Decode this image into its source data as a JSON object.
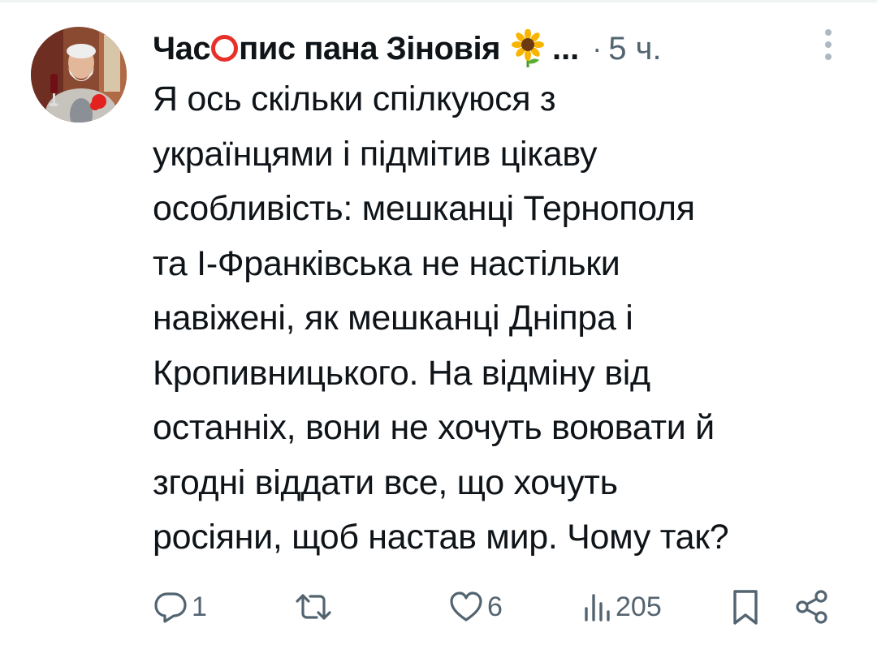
{
  "post": {
    "author": {
      "name_part1": "Час",
      "name_part2": "пис пана Зіновія",
      "ellipsis": "...",
      "avatar_icon": "person-portrait-avatar",
      "ring_icon": "red-ring-icon",
      "emoji_icon": "sunflower-icon"
    },
    "separator": "·",
    "time": "5 ч.",
    "text": "Я ось скільки спілкуюся з\nукраїнцями і підмітив цікаву\nособливість: мешканці Тернополя\nта І-Франківська не настільки\nнавіжені, як мешканці Дніпра і\nКропивницького. На відміну від\nостанніх, вони не хочуть воювати й\nзгодні віддати все, що хочуть\nросіяни, щоб настав мир. Чому так?",
    "actions": {
      "reply_count": "1",
      "repost_count": "",
      "like_count": "6",
      "views_count": "205"
    }
  },
  "colors": {
    "text": "#0f1419",
    "secondary": "#536471",
    "ring": "#e8302a"
  }
}
